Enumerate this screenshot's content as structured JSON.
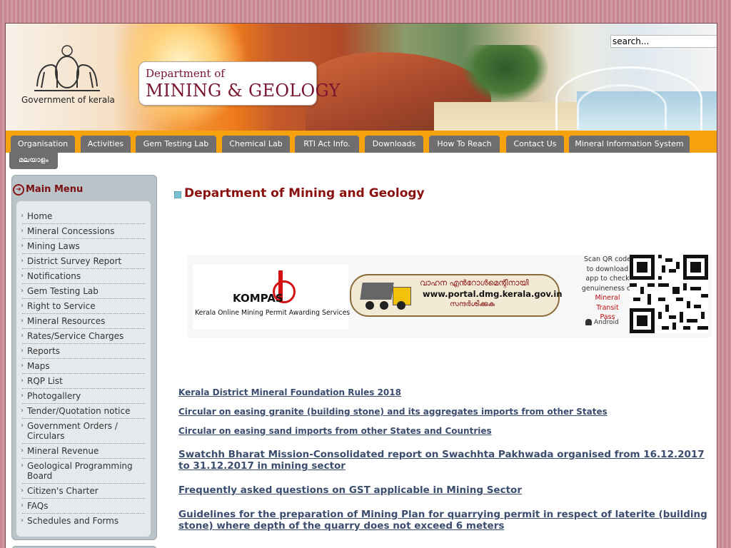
{
  "header": {
    "search_placeholder": "search...",
    "gov_label": "Government of kerala",
    "dept_line1": "Department of",
    "dept_line2": "MINING & GEOLOGY"
  },
  "nav": {
    "tabs": [
      {
        "label": "Organisation"
      },
      {
        "label": "Activities"
      },
      {
        "label": "Gem Testing Lab"
      },
      {
        "label": "Chemical Lab"
      },
      {
        "label": "RTI Act Info."
      },
      {
        "label": "Downloads"
      },
      {
        "label": "How To Reach"
      },
      {
        "label": "Contact Us"
      },
      {
        "label": "Mineral Information System"
      }
    ],
    "lang_tab": "മലയാളം"
  },
  "sidebar": {
    "title": "Main Menu",
    "items": [
      {
        "label": "Home"
      },
      {
        "label": "Mineral Concessions"
      },
      {
        "label": "Mining Laws"
      },
      {
        "label": "District Survey Report"
      },
      {
        "label": "Notifications"
      },
      {
        "label": "Gem Testing Lab"
      },
      {
        "label": "Right to Service"
      },
      {
        "label": "Mineral Resources"
      },
      {
        "label": "Rates/Service Charges"
      },
      {
        "label": "Reports"
      },
      {
        "label": "Maps"
      },
      {
        "label": "RQP List"
      },
      {
        "label": "Photogallery"
      },
      {
        "label": "Tender/Quotation notice"
      },
      {
        "label": "Government Orders / Circulars"
      },
      {
        "label": "Mineral Revenue"
      },
      {
        "label": "Geological Programming Board"
      },
      {
        "label": "Citizen's Charter"
      },
      {
        "label": "FAQs"
      },
      {
        "label": "Schedules and Forms"
      }
    ]
  },
  "main": {
    "title": "Department of Mining and Geology",
    "banner": {
      "kompas_name": "KOMPAS",
      "kompas_sub": "Kerala Online Mining Permit Awarding Services",
      "vehicle_l1": "വാഹന എൻറോൾമെന്റിനായി",
      "vehicle_url": "www.portal.dmg.kerala.gov.in",
      "vehicle_l3": "സന്ദർശിക്കുക",
      "qr_line1": "Scan QR code",
      "qr_line2": "to download",
      "qr_line3": "app to check",
      "qr_line4": "genuineness of",
      "qr_red1": "Mineral",
      "qr_red2": "Transit",
      "qr_red3": "Pass",
      "android": "Android"
    },
    "links": [
      {
        "text": "Kerala District Mineral Foundation Rules 2018"
      },
      {
        "text": "Circular on easing granite (building stone) and its aggregates  imports from other States"
      },
      {
        "text": "Circular on easing sand imports from other States and Countries"
      },
      {
        "text": "Swatchh Bharat Mission-Consolidated report on Swachhta Pakhwada organised from 16.12.2017 to 31.12.2017 in mining sector"
      },
      {
        "text": "Frequently asked questions on GST applicable in Mining Sector"
      },
      {
        "text": "Guidelines for the preparation of Mining Plan for quarrying permit in respect of laterite (building stone) where depth of the quarry does not exceed 6 meters"
      }
    ]
  }
}
